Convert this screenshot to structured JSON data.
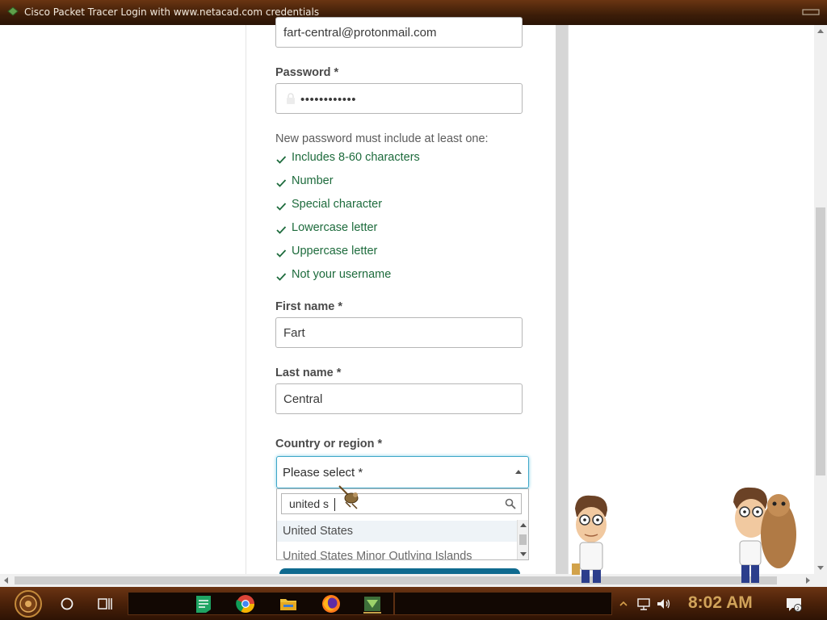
{
  "window": {
    "title": "Cisco Packet Tracer Login with www.netacad.com credentials"
  },
  "form": {
    "email_value": "fart-central@protonmail.com",
    "password_label": "Password *",
    "password_value": "••••••••••••",
    "rules_intro": "New password must include at least one:",
    "rules": [
      "Includes 8-60 characters",
      "Number",
      "Special character",
      "Lowercase letter",
      "Uppercase letter",
      "Not your username"
    ],
    "first_name_label": "First name *",
    "first_name_value": "Fart",
    "last_name_label": "Last name *",
    "last_name_value": "Central",
    "country_label": "Country or region *",
    "country_select_value": "Please select *",
    "country_search_value": "united s",
    "country_options": [
      "United States",
      "United States Minor Outlying Islands"
    ]
  },
  "taskbar": {
    "clock": "8:02 AM",
    "apps": [
      "start-button",
      "cortana-icon",
      "task-view-icon",
      "sheets-icon",
      "chrome-icon",
      "file-explorer-icon",
      "firefox-icon",
      "packet-tracer-icon"
    ]
  },
  "colors": {
    "titlebar": "#4a2109",
    "check_green": "#1d6b3c",
    "focus_blue": "#3fa7c8",
    "clock": "#d1a35a"
  }
}
